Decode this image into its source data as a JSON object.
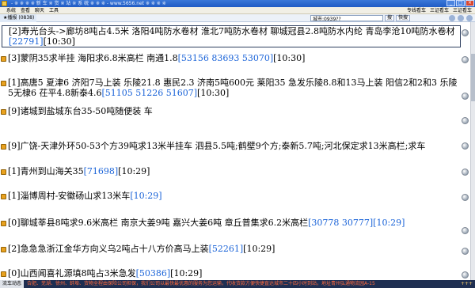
{
  "window": {
    "title": "- ※ ※ ※ ※ 新 车 ※ 货 ※ 站 ※ 系 统 ※ ※ ※ - www.5656.net ※ ※ ※ ※"
  },
  "menu": {
    "items": [
      "系统",
      "查看",
      "聊天",
      "工具"
    ],
    "right": [
      "专线看车",
      "三证看车",
      "三证看车"
    ]
  },
  "toolbar": {
    "tab_label": "★播报",
    "count": "(0838)",
    "search_value": "城市:0939??",
    "search_button": "搜",
    "clear_button": "快搜"
  },
  "messages": [
    {
      "prefix": "[2]",
      "text": "寿光台头->廊坊8吨占4.5米 洛阳4吨防水卷材 淮北7吨防水卷材 聊城冠县2.8吨防水内纶 青岛李沧10吨防水卷材",
      "id": "[22791]",
      "time": "[10:30]",
      "selected": true
    },
    {
      "prefix": "[3]",
      "text": "蒙阴35求半挂 海阳求6.8米高栏 南通1.8",
      "id": "[53156 83693 53070]",
      "time": "[10:30]",
      "selected": false
    },
    {
      "prefix": "[1]",
      "text": "高唐5 夏津6 济阳7马上装 乐陵21.8 惠民2.3 济南5吨600元 莱阳35 急发乐陵8.8和13马上装 阳信2和2和3 乐陵5无棣6 茌平4.8新泰4.6",
      "id": "[51105 51226 51607]",
      "time": "[10:30]",
      "selected": false
    },
    {
      "prefix": "[9]",
      "text": "诸城到盐城东台35-50吨随便装 车",
      "id": "",
      "time": "",
      "selected": false
    },
    {
      "prefix": "[9]",
      "text": "广饶-天津外环50-53个方39吨求13米半挂车 泗县5.5吨;鹤壁9个方;泰新5.7吨;河北保定求13米高栏;求车",
      "id": "",
      "time": "",
      "selected": false
    },
    {
      "prefix": "[1]",
      "text": "青州到山海关35",
      "id": "[71698]",
      "time": "[10:29]",
      "selected": false
    },
    {
      "prefix": "[1]",
      "text": "淄博周村-安徽砀山求13米车",
      "id": "",
      "time": "[10:29]",
      "selected": false
    },
    {
      "prefix": "[0]",
      "text": "聊城莘县8吨求9.6米高栏 南京大姜9吨 嘉兴大姜6吨 章丘普集求6.2米高栏",
      "id": "[30778 30777]",
      "time": "[10:29]",
      "selected": false
    },
    {
      "prefix": "[2]",
      "text": "急急急浙江金华方向义乌2吨占十八方价高马上装",
      "id": "[52261]",
      "time": "[10:29]",
      "selected": false
    },
    {
      "prefix": "[0]",
      "text": "山西闻喜礼源填8吨占3米急发",
      "id": "[50386]",
      "time": "[10:29]",
      "selected": false
    }
  ],
  "status": {
    "label": "流车动态",
    "ticker": "合肥、芜湖、徐州、蚌埠、货物全程由保险公司担保，我们公司以最快最优惠的服务为您运输，代收货款方便快捷直达城市二十四小时到站，地址青州弘通物流园A-15",
    "end": "+++"
  }
}
